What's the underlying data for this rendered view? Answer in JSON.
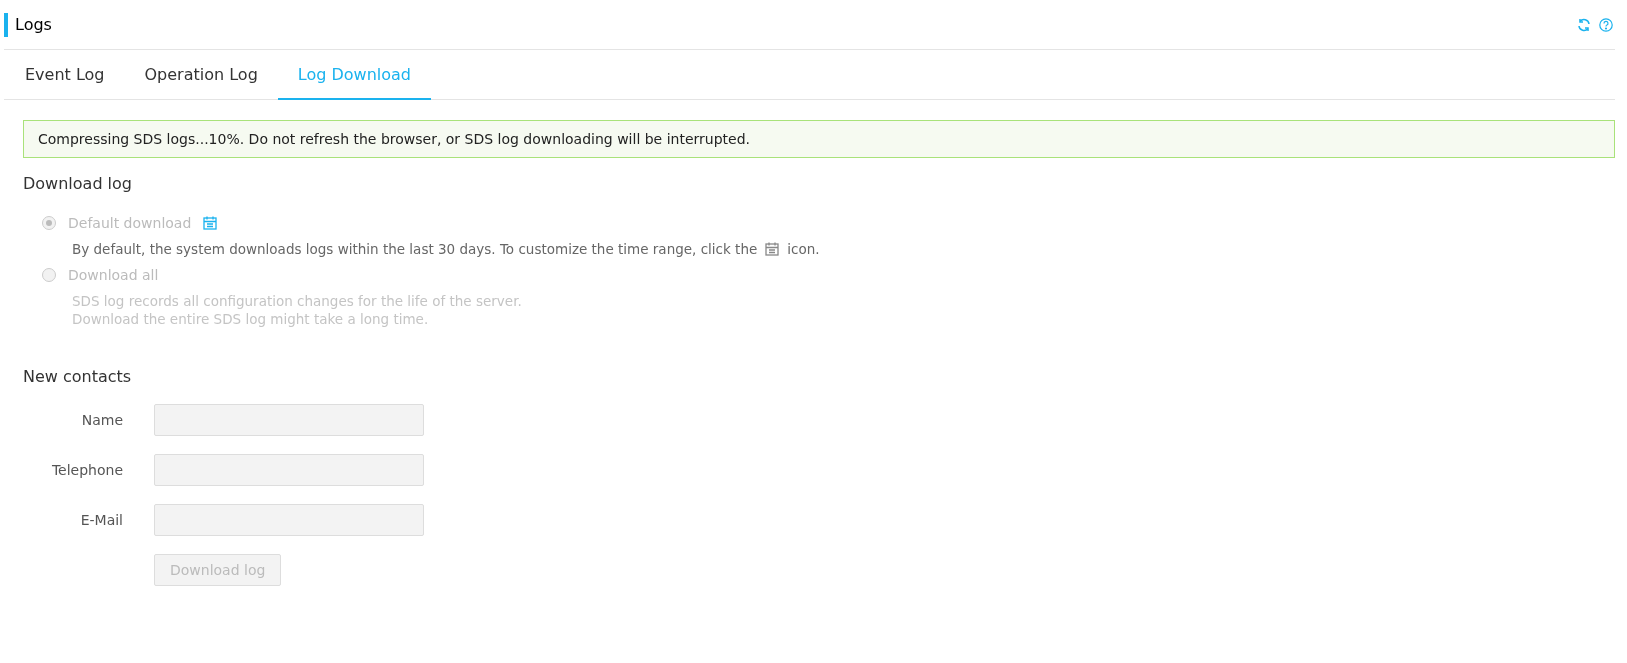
{
  "page": {
    "title": "Logs"
  },
  "tabs": [
    {
      "label": "Event Log",
      "selected": false
    },
    {
      "label": "Operation Log",
      "selected": false
    },
    {
      "label": "Log Download",
      "selected": true
    }
  ],
  "alert": {
    "text": "Compressing SDS logs...10%. Do not refresh the browser, or SDS log downloading will be interrupted."
  },
  "download_log": {
    "heading": "Download log",
    "options": [
      {
        "label": "Default download",
        "selected": true,
        "disabled": true,
        "calendar_button": true,
        "description": [
          "By default, the system downloads logs within the last 30 days. To customize the time range, click the",
          "icon."
        ],
        "description_disabled": false
      },
      {
        "label": "Download all",
        "selected": false,
        "disabled": true,
        "calendar_button": false,
        "description": [
          "SDS log records all configuration changes for the life of the server.",
          "Download the entire SDS log might take a long time."
        ],
        "description_disabled": true
      }
    ]
  },
  "new_contacts": {
    "heading": "New contacts",
    "fields": [
      {
        "label": "Name",
        "disabled": true
      },
      {
        "label": "Telephone",
        "disabled": true
      },
      {
        "label": "E-Mail",
        "disabled": true
      }
    ],
    "button": {
      "label": "Download log",
      "disabled": true
    }
  }
}
